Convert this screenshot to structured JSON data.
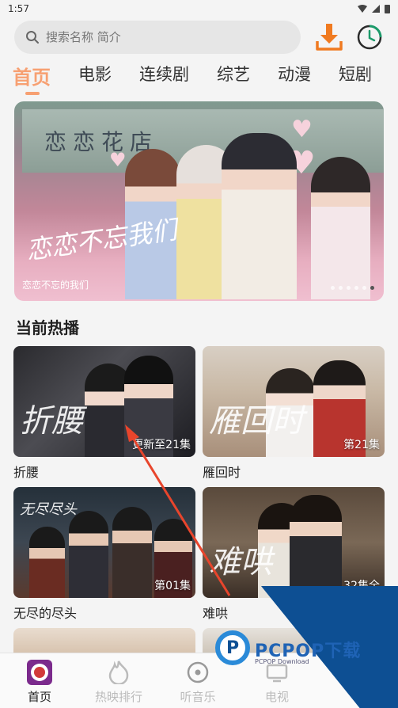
{
  "status": {
    "time": "1:57"
  },
  "search": {
    "placeholder": "搜索名称 简介"
  },
  "tabs": [
    {
      "label": "首页"
    },
    {
      "label": "电影"
    },
    {
      "label": "连续剧"
    },
    {
      "label": "综艺"
    },
    {
      "label": "动漫"
    },
    {
      "label": "短剧"
    }
  ],
  "banner": {
    "sign_text": "恋恋花店",
    "logo_text": "恋恋不忘我们",
    "caption": "恋恋不忘的我们",
    "dot_count": 6,
    "active_dot": 5
  },
  "section": {
    "title": "当前热播"
  },
  "cards": [
    {
      "title": "折腰",
      "badge": "更新至21集",
      "art_title": "折腰"
    },
    {
      "title": "雁回时",
      "badge": "第21集",
      "art_title": "雁回时"
    },
    {
      "title": "无尽的尽头",
      "badge": "第01集",
      "art_title": "无尽尽头"
    },
    {
      "title": "难哄",
      "badge": "32集全",
      "art_title": "难哄"
    }
  ],
  "bottom_nav": [
    {
      "label": "首页",
      "icon": "app-logo-icon"
    },
    {
      "label": "热映排行",
      "icon": "flame-icon"
    },
    {
      "label": "听音乐",
      "icon": "music-disc-icon"
    },
    {
      "label": "电视",
      "icon": "tv-icon"
    }
  ],
  "watermark": {
    "text": "PCPOP下载",
    "sub": "PCPOP Download"
  },
  "colors": {
    "accent": "#f7a072",
    "download": "#f07a20",
    "history": "#1c9a6a"
  }
}
